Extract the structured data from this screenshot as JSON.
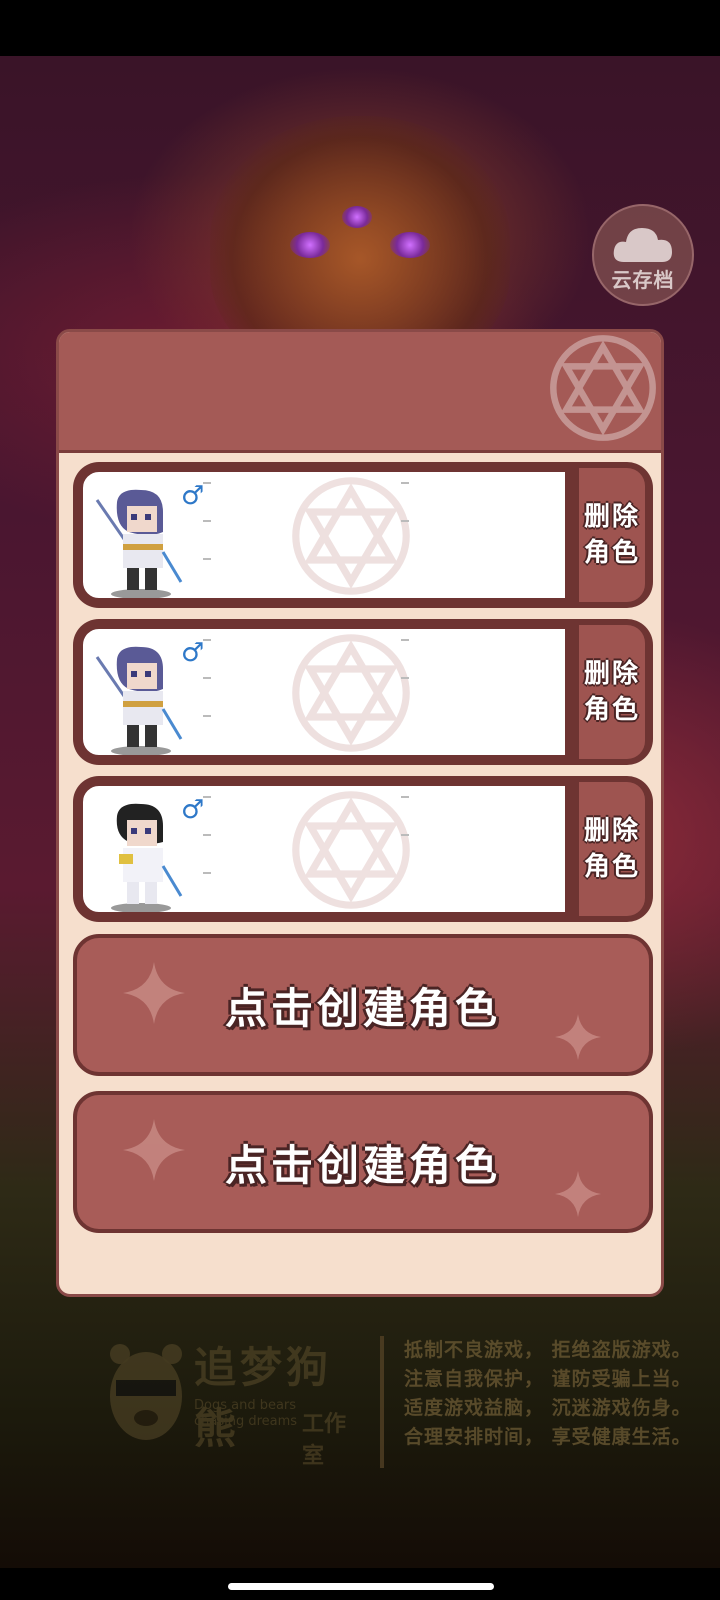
{
  "cloud_save": {
    "label": "云存档",
    "icon": "cloud-icon"
  },
  "characters": [
    {
      "delete_label_line1": "删除",
      "delete_label_line2": "角色",
      "gender_icon": "male-icon",
      "hair": "purple"
    },
    {
      "delete_label_line1": "删除",
      "delete_label_line2": "角色",
      "gender_icon": "male-icon",
      "hair": "purple"
    },
    {
      "delete_label_line1": "删除",
      "delete_label_line2": "角色",
      "gender_icon": "male-icon",
      "hair": "black"
    }
  ],
  "create_slots": [
    {
      "label": "点击创建角色"
    },
    {
      "label": "点击创建角色"
    }
  ],
  "footer": {
    "brand_cn": "追梦狗熊",
    "brand_en": "Dogs and bears chasing dreams",
    "brand_studio": "工作室",
    "notice_lines": [
      "抵制不良游戏， 拒绝盗版游戏。",
      "注意自我保护， 谨防受骗上当。",
      "适度游戏益脑， 沉迷游戏伤身。",
      "合理安排时间， 享受健康生活。"
    ]
  },
  "colors": {
    "panel_bg": "#f6dfcd",
    "panel_header": "#a45a56",
    "button_fill": "#a85c58",
    "button_border": "#6e3432",
    "gender_blue": "#2e78c8"
  }
}
